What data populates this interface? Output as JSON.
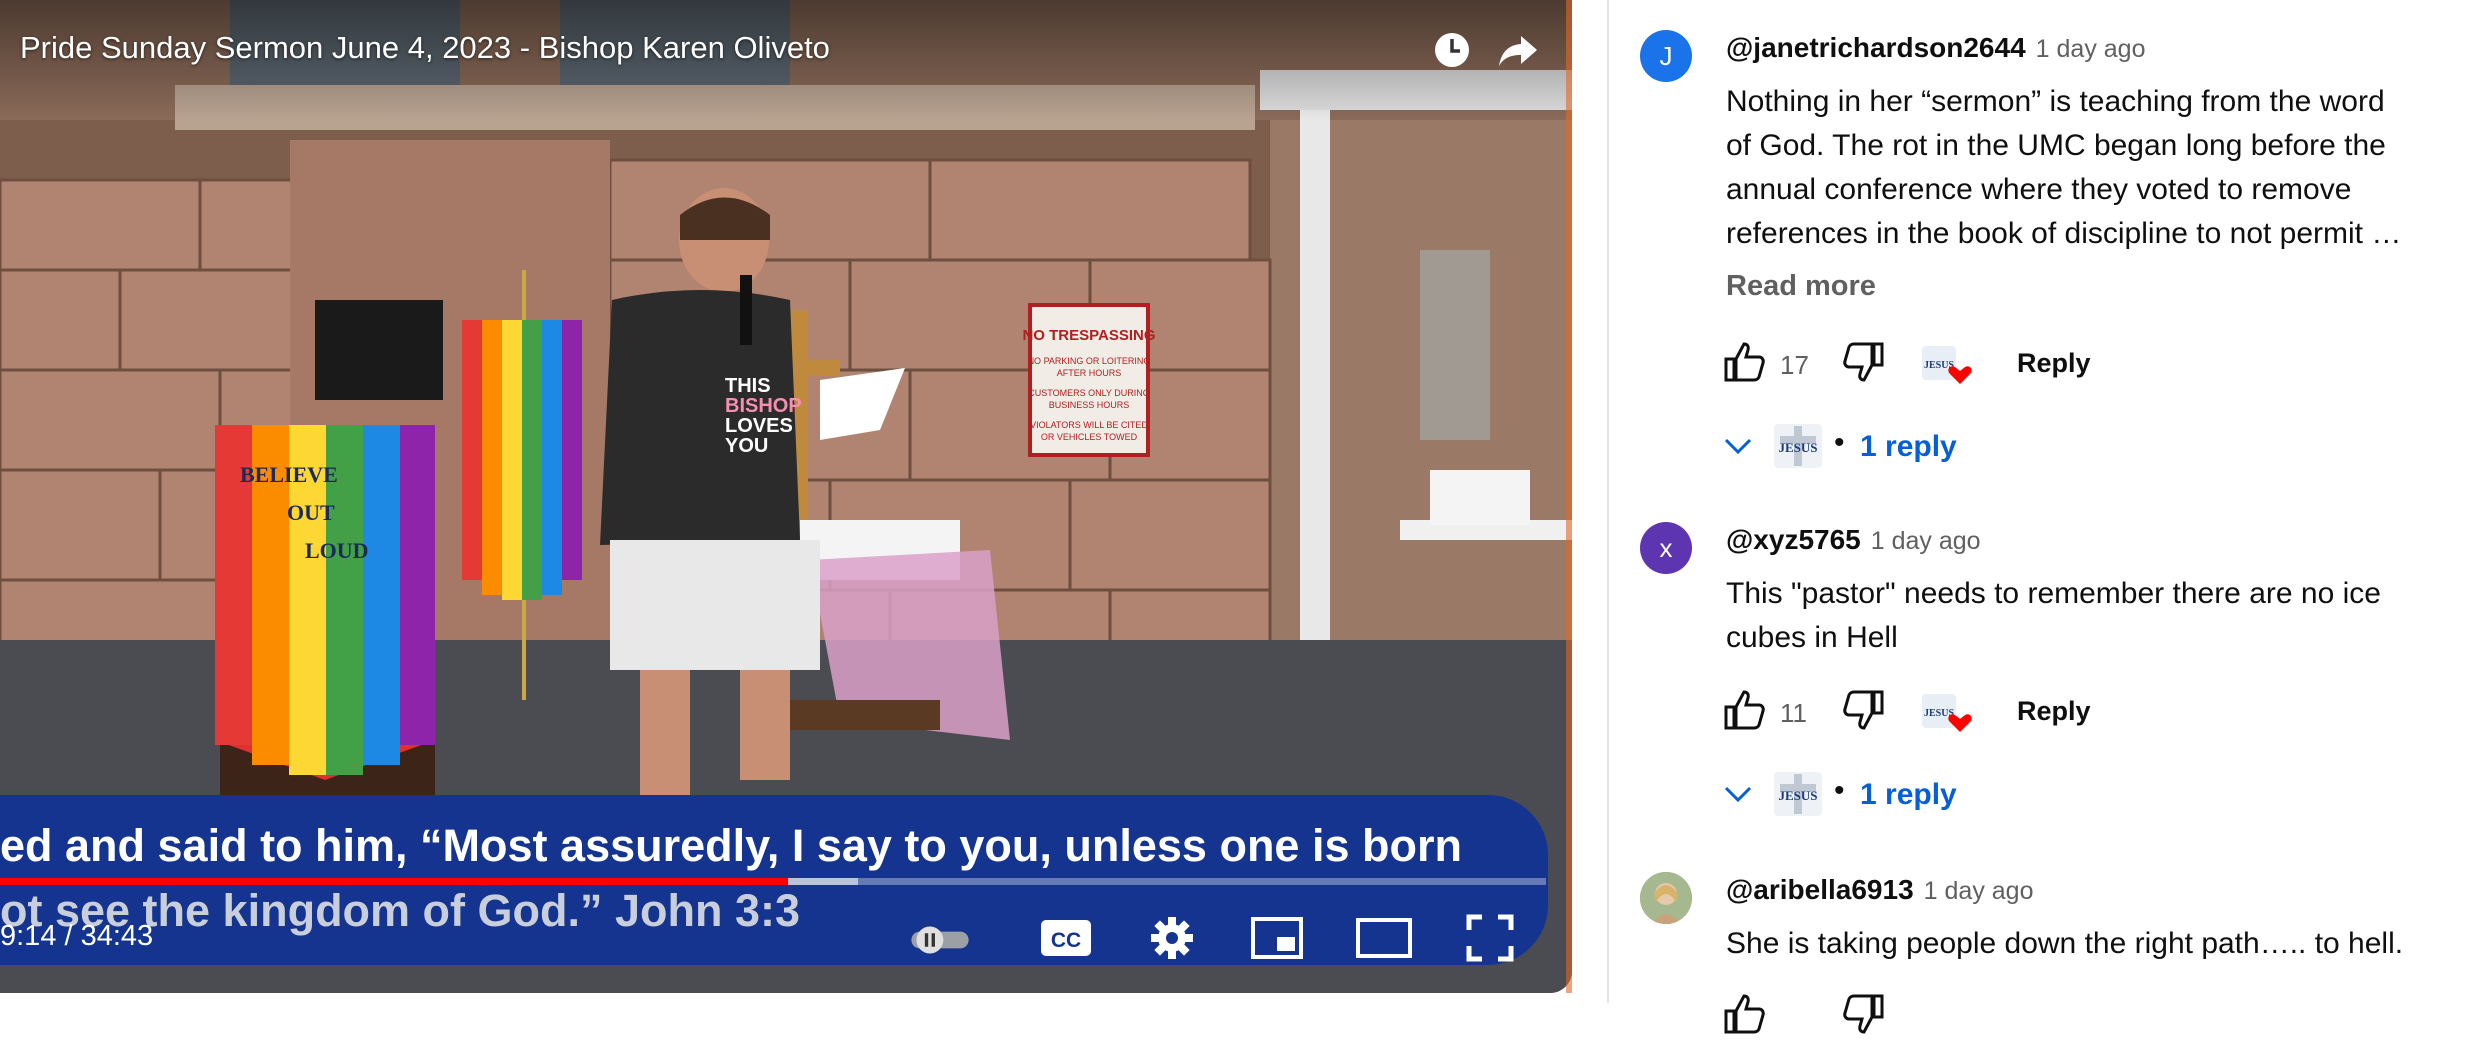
{
  "player": {
    "title": "Pride Sunday Sermon June 4, 2023 - Bishop Karen Oliveto",
    "caption_line_1": "ed and said to him, “Most assuredly, I say to you, unless one is born",
    "caption_line_2": "ot see the kingdom of God.” John 3:3",
    "time": "9:14 / 34:43",
    "progress_fraction": 0.51,
    "buffer_fraction": 0.555,
    "banner_left_text": [
      "BELIEVE",
      "OUT",
      "LOUD"
    ],
    "sign_text": [
      "NO TRESPASSING",
      "NO PARKING OR LOITERING",
      "AFTER HOURS",
      "CUSTOMERS ONLY DURING",
      "BUSINESS HOURS",
      "VIOLATORS WILL BE CITED",
      "OR VEHICLES TOWED"
    ],
    "shirt_text": [
      "THIS",
      "BISHOP",
      "LOVES",
      "YOU"
    ],
    "controls": [
      "watch-later",
      "share",
      "autoplay-toggle",
      "captions",
      "settings",
      "miniplayer",
      "theater-mode",
      "fullscreen"
    ]
  },
  "comments": [
    {
      "avatar_letter": "J",
      "avatar_color": "#1a73e8",
      "handle": "@janetrichardson2644",
      "time": "1 day ago",
      "lines": [
        "Nothing in her “sermon” is teaching from the word",
        "of God. The rot in the UMC began long before the",
        "annual conference where they voted to remove",
        "references in the book of discipline to not permit …"
      ],
      "read_more": "Read more",
      "likes": "17",
      "reply_label": "Reply",
      "replies_label": "1 reply",
      "logo_text": "JESUS"
    },
    {
      "avatar_letter": "x",
      "avatar_color": "#5e35b1",
      "handle": "@xyz5765",
      "time": "1 day ago",
      "lines": [
        "This \"pastor\" needs to remember there are no ice",
        "cubes in Hell"
      ],
      "likes": "11",
      "reply_label": "Reply",
      "replies_label": "1 reply",
      "logo_text": "JESUS"
    },
    {
      "avatar_letter": "",
      "avatar_color": "#8aa17a",
      "handle": "@aribella6913",
      "time": "1 day ago",
      "lines": [
        "She is taking people down the right path….. to hell."
      ]
    }
  ],
  "colors": {
    "accent_blue": "#065fd4",
    "progress_red": "#ff0000",
    "caption_band": "#14348f",
    "heart_red": "#ff0000"
  }
}
